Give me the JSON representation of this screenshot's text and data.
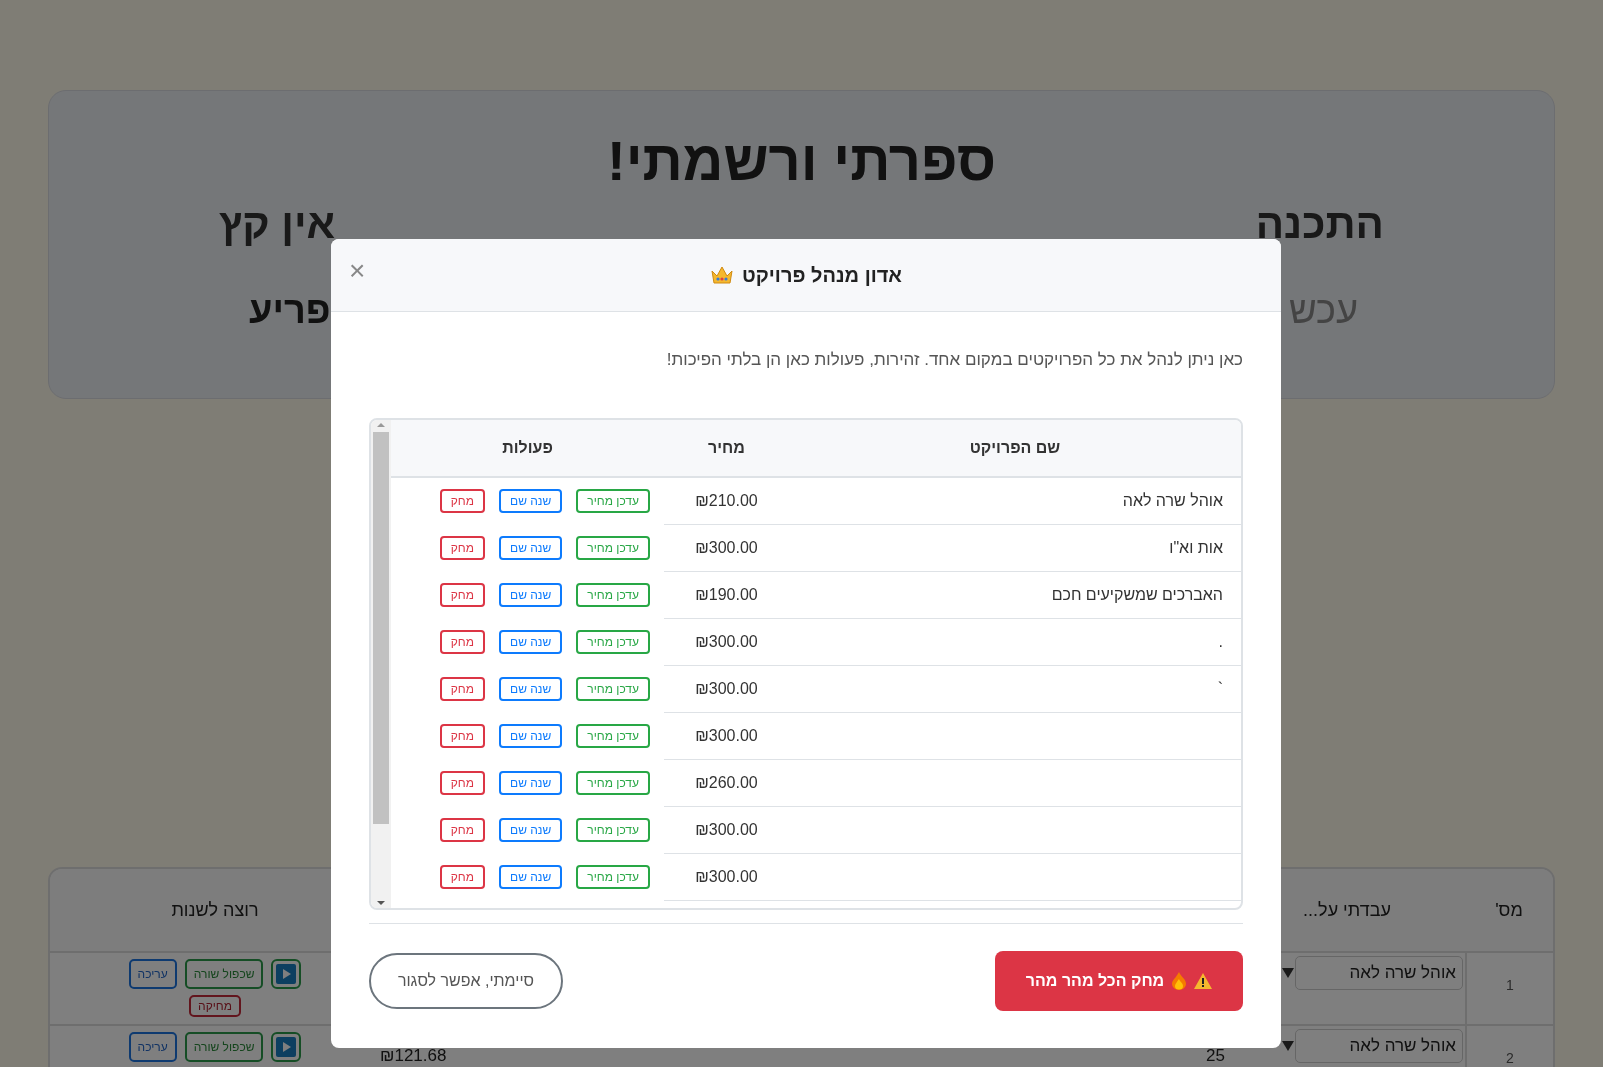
{
  "background_page": {
    "hero": {
      "title": "ספרתי ורשמתי!",
      "subtitle_fragments": [
        "התכנה",
        "אין קץ"
      ],
      "line_3_fragments": [
        "עכש",
        "פריע"
      ]
    },
    "table": {
      "columns": [
        "מס'",
        "עבדתי על...",
        "רוצה לשנות"
      ],
      "rows": [
        {
          "number": "1",
          "project": "אוהל שרה לאה",
          "actions": [
            "שכפול שורה",
            "עריכה",
            "מחיקה"
          ]
        },
        {
          "number": "2",
          "project": "אוהל שרה לאה",
          "hours": "25",
          "price": "₪121.68",
          "actions": [
            "שכפול שורה",
            "עריכה"
          ]
        }
      ]
    }
  },
  "modal": {
    "close": "×",
    "title": "אדון מנהל פרויקט",
    "description": "כאן ניתן לנהל את כל הפרויקטים במקום אחד. זהירות, פעולות כאן הן בלתי הפיכות!",
    "table": {
      "columns": [
        "שם הפרויקט",
        "מחיר",
        "פעולות"
      ],
      "rows": [
        {
          "name": "אוהל שרה לאה",
          "price": "₪210.00",
          "actions": [
            "עדכן מחיר",
            "שנה שם",
            "מחק"
          ]
        },
        {
          "name": "אות וא\"ו",
          "price": "₪300.00",
          "actions": [
            "עדכן מחיר",
            "שנה שם",
            "מחק"
          ]
        },
        {
          "name": "האברכים שמשקיעים חכם",
          "price": "₪190.00",
          "actions": [
            "עדכן מחיר",
            "שנה שם",
            "מחק"
          ]
        },
        {
          "name": ".",
          "price": "₪300.00",
          "actions": [
            "עדכן מחיר",
            "שנה שם",
            "מחק"
          ]
        },
        {
          "name": "`",
          "price": "₪300.00",
          "actions": [
            "עדכן מחיר",
            "שנה שם",
            "מחק"
          ]
        },
        {
          "price": "₪300.00",
          "actions": [
            "עדכן מחיר",
            "שנה שם",
            "מחק"
          ]
        },
        {
          "price": "₪260.00",
          "actions": [
            "עדכן מחיר",
            "שנה שם",
            "מחק"
          ]
        },
        {
          "price": "₪300.00",
          "actions": [
            "עדכן מחיר",
            "שנה שם",
            "מחק"
          ]
        },
        {
          "price": "₪300.00",
          "actions": [
            "עדכן מחיר",
            "שנה שם",
            "מחק"
          ]
        }
      ]
    },
    "danger_button": "מחק הכל מהר מהר",
    "close_button": "סיימתי, אפשר לסגור"
  }
}
